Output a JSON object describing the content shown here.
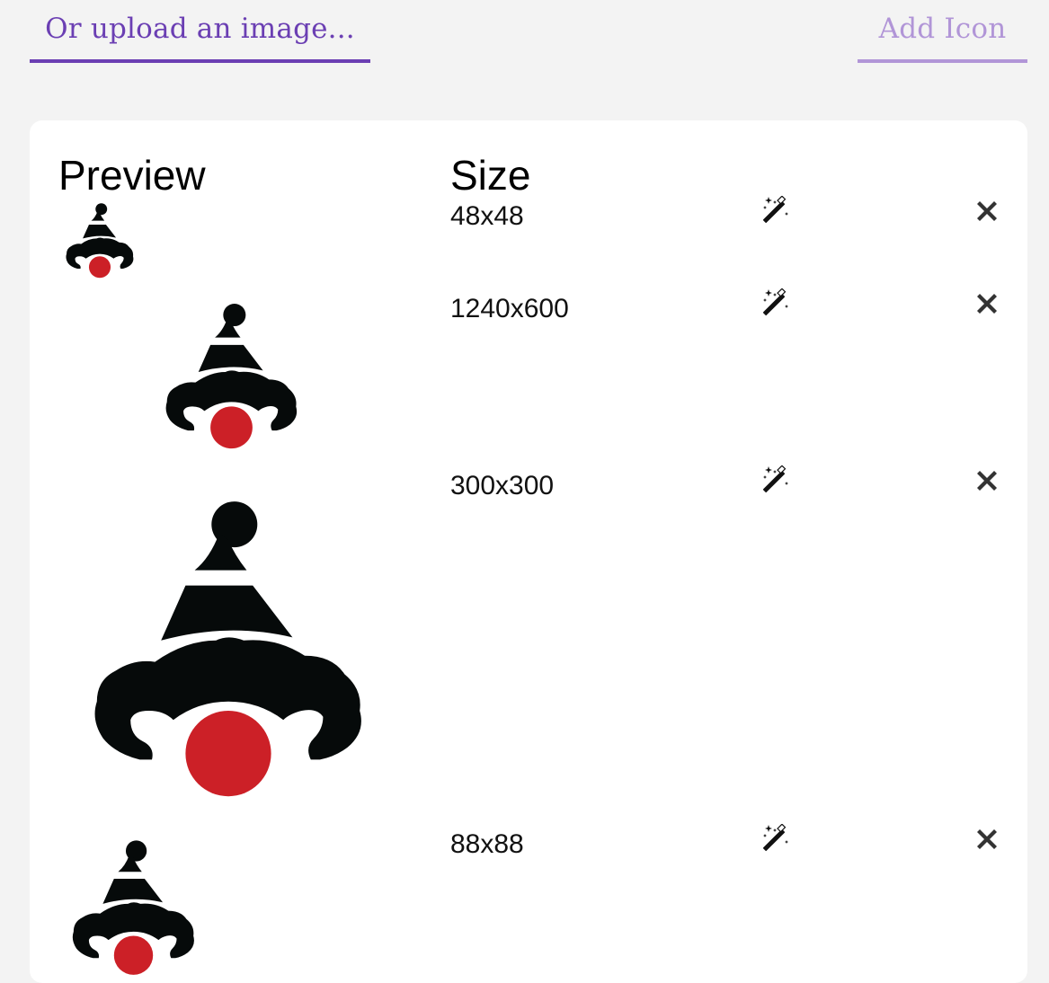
{
  "tabs": {
    "upload_label": "Or upload an image...",
    "add_label": "Add Icon"
  },
  "table": {
    "headers": {
      "preview": "Preview",
      "size": "Size"
    },
    "rows": [
      {
        "size": "48x48"
      },
      {
        "size": "1240x600"
      },
      {
        "size": "300x300"
      },
      {
        "size": "88x88"
      }
    ]
  },
  "icons": {
    "generate": "magic-wand-icon",
    "remove": "close-icon",
    "preview": "clown-logo-icon"
  },
  "colors": {
    "accent": "#6b3fb3",
    "accent_light": "#b195d7",
    "clown_black": "#060a0a",
    "clown_red": "#cc2027"
  }
}
